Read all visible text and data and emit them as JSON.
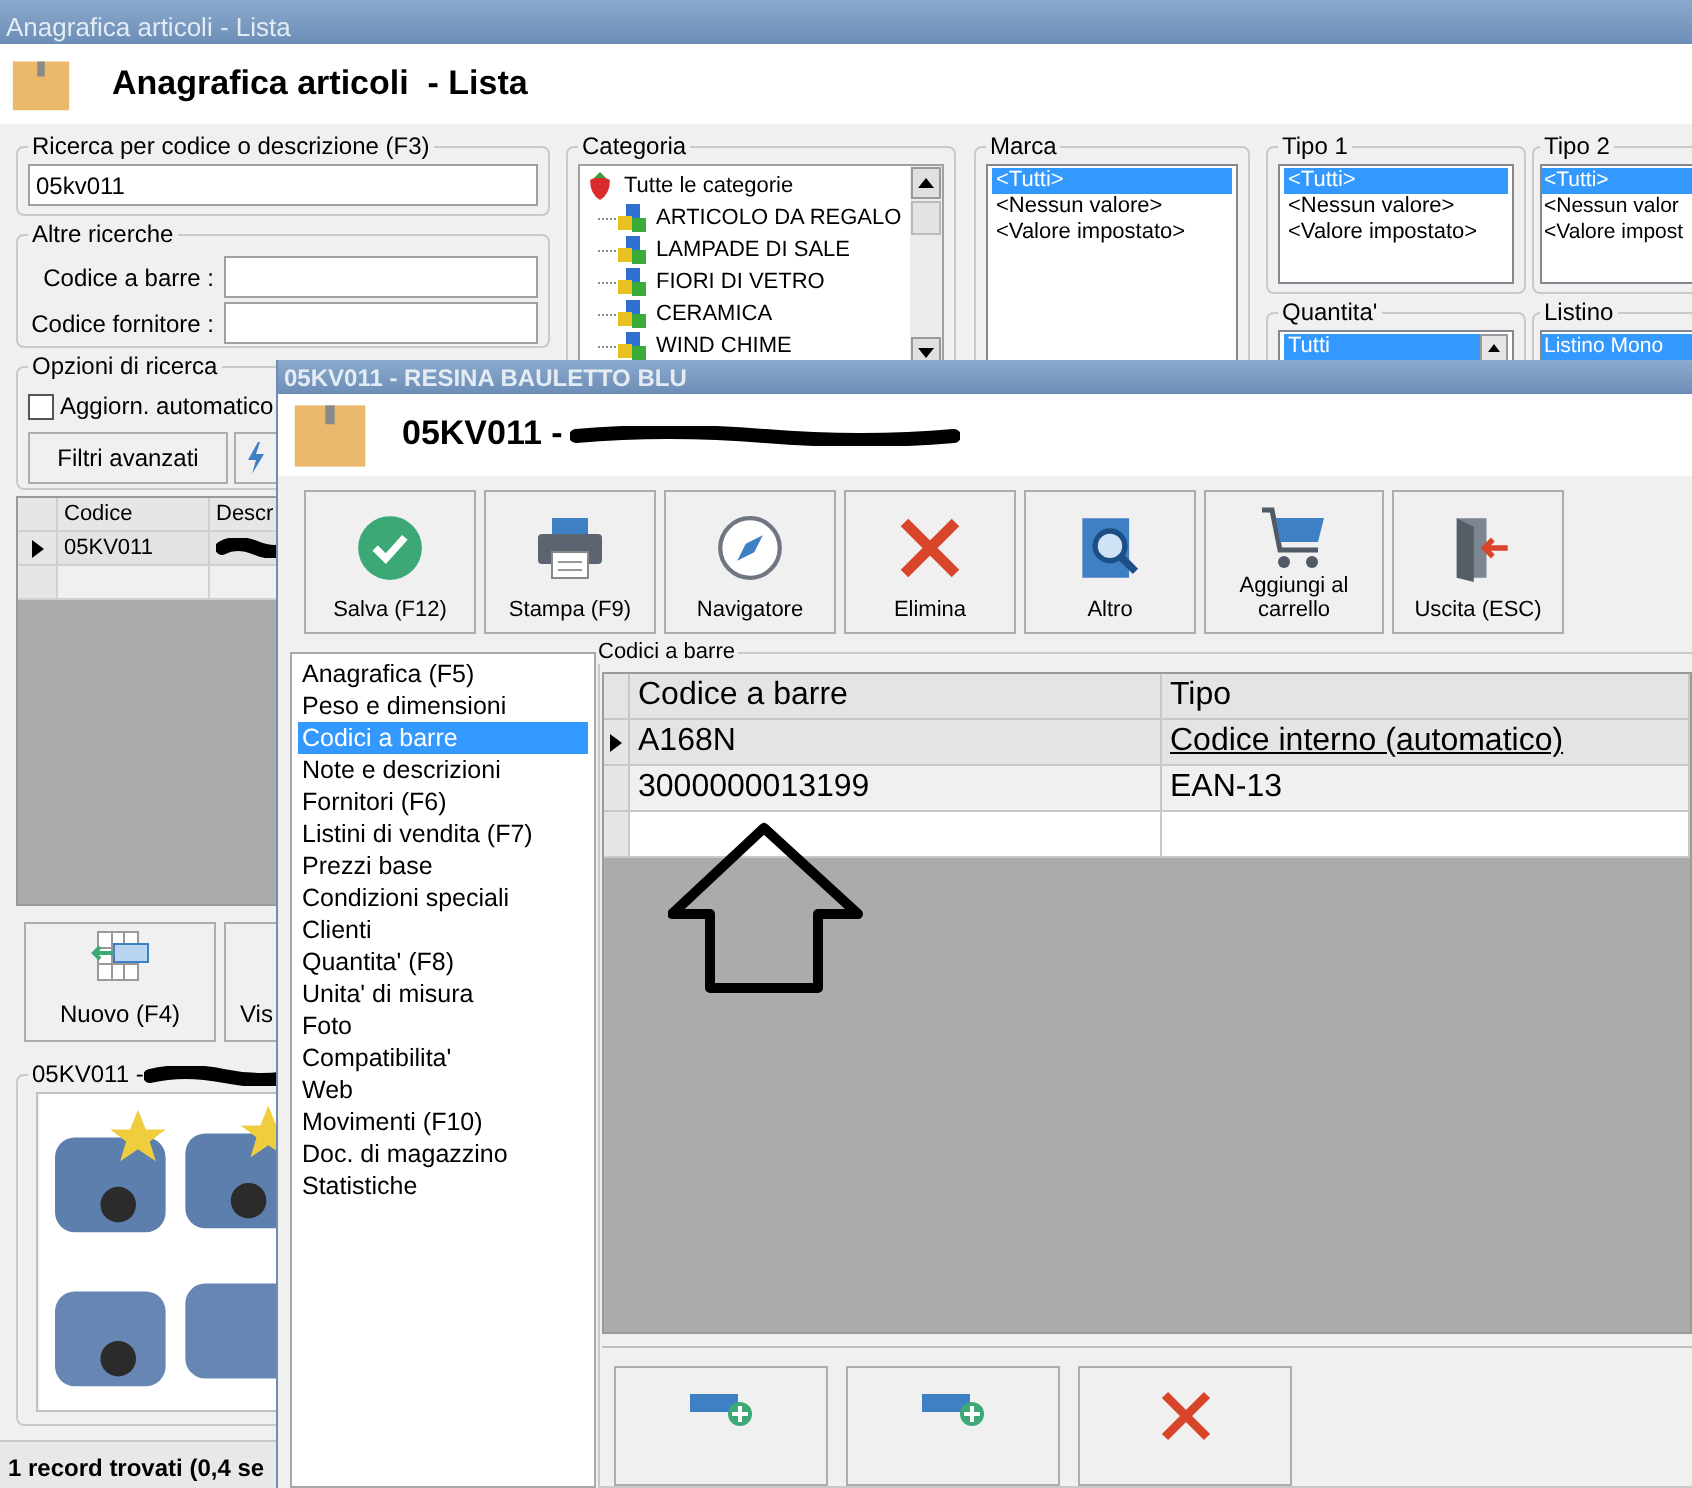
{
  "main_window": {
    "title": "Anagrafica articoli  - Lista",
    "heading": "Anagrafica articoli  - Lista",
    "search": {
      "label": "Ricerca per codice o descrizione (F3)",
      "value": "05kv011"
    },
    "other_searches": {
      "label": "Altre ricerche",
      "fields": [
        {
          "label": "Codice a barre :"
        },
        {
          "label": "Codice fornitore :"
        }
      ]
    },
    "search_options": {
      "label": "Opzioni di ricerca",
      "auto_update": {
        "label": "Aggiorn. automatico",
        "checked": false
      },
      "button": "Filtri avanzati"
    },
    "category": {
      "label": "Categoria",
      "tree": {
        "label": "Tutte le categorie",
        "children": [
          {
            "label": "ARTICOLO DA REGALO"
          },
          {
            "label": "LAMPADE DI SALE"
          },
          {
            "label": "FIORI DI VETRO"
          },
          {
            "label": "CERAMICA"
          },
          {
            "label": "WIND CHIME"
          }
        ]
      }
    },
    "filters": [
      {
        "label": "Marca",
        "options": [
          {
            "label": "<Tutti>",
            "selected": true
          },
          {
            "label": "<Nessun valore>",
            "selected": false
          },
          {
            "label": "<Valore impostato>",
            "selected": false
          }
        ]
      },
      {
        "label": "Tipo 1",
        "options": [
          {
            "label": "<Tutti>",
            "selected": true
          },
          {
            "label": "<Nessun valore>",
            "selected": false
          },
          {
            "label": "<Valore impostato>",
            "selected": false
          }
        ]
      },
      {
        "label": "Tipo 2",
        "options": [
          {
            "label": "<Tutti>",
            "selected": true
          },
          {
            "label": "<Nessun valor",
            "selected": false
          },
          {
            "label": "<Valore impost",
            "selected": false
          }
        ]
      },
      {
        "label": "Quantita'",
        "options": [
          {
            "label": "Tutti",
            "selected": true
          }
        ]
      },
      {
        "label": "Listino",
        "options": [
          {
            "label": "Listino Mono",
            "selected": true
          }
        ]
      }
    ],
    "results": {
      "columns": [
        "Codice",
        "Descr"
      ],
      "rows": [
        {
          "code": "05KV011",
          "current": true
        }
      ]
    },
    "actions": [
      "Nuovo (F4)",
      "Vis"
    ],
    "photo": {
      "title": "05KV011 -"
    },
    "status_bar": "1 record trovati (0,4 se"
  },
  "detail_window": {
    "title": "05KV011 - RESINA BAULETTO BLU",
    "heading": "05KV011 -",
    "toolbar": [
      {
        "label": "Salva (F12)",
        "kind": "save"
      },
      {
        "label": "Stampa (F9)",
        "kind": "print"
      },
      {
        "label": "Navigatore",
        "kind": "navigator"
      },
      {
        "label": "Elimina",
        "kind": "delete"
      },
      {
        "label": "Altro",
        "kind": "more"
      },
      {
        "label": "Aggiungi al carrello",
        "kind": "cart"
      },
      {
        "label": "Uscita (ESC)",
        "kind": "exit"
      }
    ],
    "sections": [
      {
        "label": "Anagrafica (F5)",
        "selected": false
      },
      {
        "label": "Peso e dimensioni",
        "selected": false
      },
      {
        "label": "Codici a barre",
        "selected": true
      },
      {
        "label": "Note e descrizioni",
        "selected": false
      },
      {
        "label": "Fornitori (F6)",
        "selected": false
      },
      {
        "label": "Listini di vendita (F7)",
        "selected": false
      },
      {
        "label": "Prezzi base",
        "selected": false
      },
      {
        "label": "Condizioni speciali",
        "selected": false
      },
      {
        "label": "Clienti",
        "selected": false
      },
      {
        "label": "Quantita' (F8)",
        "selected": false
      },
      {
        "label": "Unita' di misura",
        "selected": false
      },
      {
        "label": "Foto",
        "selected": false
      },
      {
        "label": "Compatibilita'",
        "selected": false
      },
      {
        "label": "Web",
        "selected": false
      },
      {
        "label": "Movimenti (F10)",
        "selected": false
      },
      {
        "label": "Doc. di magazzino",
        "selected": false
      },
      {
        "label": "Statistiche",
        "selected": false
      }
    ],
    "barcodes": {
      "title": "Codici a barre",
      "columns": [
        "Codice a barre",
        "Tipo"
      ],
      "rows": [
        {
          "code": "A168N",
          "type": "Codice interno (automatico)",
          "current": true
        },
        {
          "code": "3000000013199",
          "type": "EAN-13",
          "current": false
        }
      ]
    },
    "bottom_buttons": [
      {
        "kind": "add"
      },
      {
        "kind": "add"
      },
      {
        "kind": "delete"
      }
    ]
  }
}
